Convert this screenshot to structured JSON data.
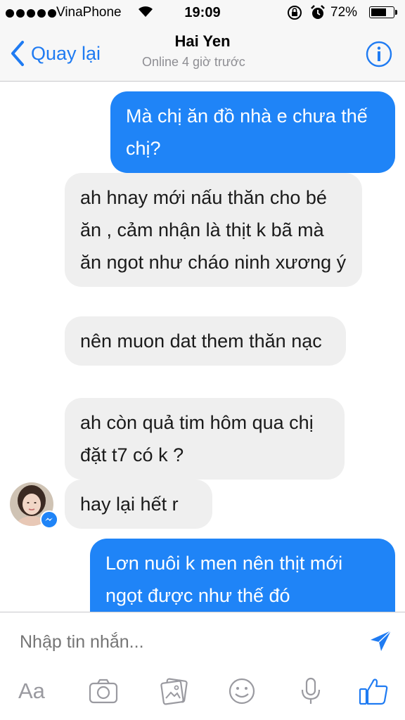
{
  "status_bar": {
    "carrier": "VinaPhone",
    "time": "19:09",
    "battery_percent": "72%",
    "battery_level": 0.72,
    "signal_dots": 5
  },
  "nav": {
    "back_label": "Quay lại",
    "title": "Hai Yen",
    "subtitle": "Online 4 giờ trước",
    "info_icon": "info-icon"
  },
  "messages": [
    {
      "direction": "outgoing",
      "text": "Mà chị ăn đồ nhà e chưa thế chị?"
    },
    {
      "direction": "incoming",
      "text": "ah hnay mới nấu thăn cho bé ăn , cảm nhận là thịt k bã mà ăn ngot như cháo ninh xương ý"
    },
    {
      "direction": "incoming",
      "text": "nên muon dat them thăn nạc"
    },
    {
      "direction": "incoming",
      "text": "ah còn quả tim hôm qua chị đặt t7 có k ?"
    },
    {
      "direction": "incoming",
      "text": "hay lại hết r"
    },
    {
      "direction": "outgoing",
      "text": "Lơn nuôi k men nên thịt mới ngọt được như thế đó"
    }
  ],
  "composer": {
    "placeholder": "Nhập tin nhắn...",
    "send_icon": "send-icon",
    "tools": {
      "text_format": "Aa",
      "camera": "camera-icon",
      "photos": "photo-icon",
      "emoji": "emoji-icon",
      "voice": "microphone-icon",
      "like": "thumbs-up-icon"
    }
  },
  "colors": {
    "accent": "#1f7bf2",
    "outgoing_bubble": "#1f84f7",
    "incoming_bubble": "#efefef",
    "secondary_text": "#8e8e93"
  }
}
